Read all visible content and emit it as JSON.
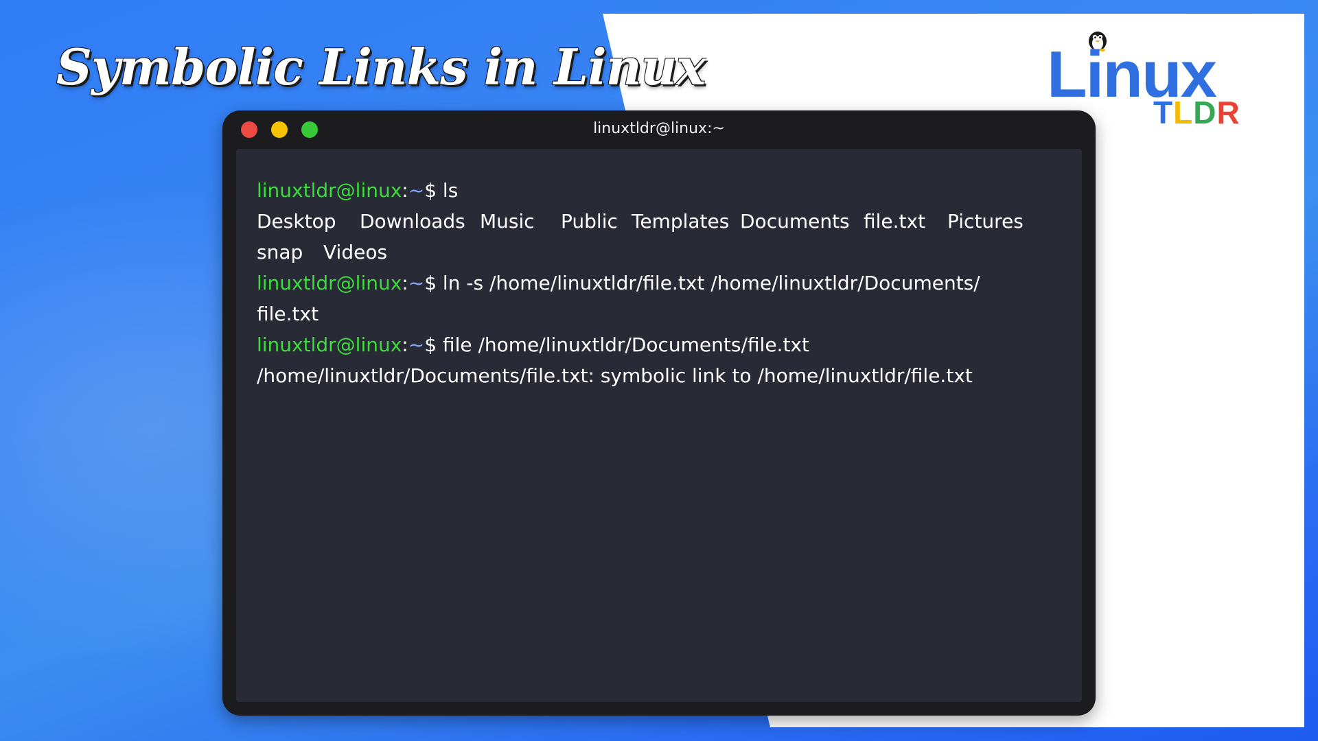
{
  "page": {
    "title": "Symbolic Links in Linux"
  },
  "logo": {
    "word": "Linux",
    "sub_letters": [
      {
        "char": "T",
        "color": "#2f6fe0"
      },
      {
        "char": "L",
        "color": "#f5b800"
      },
      {
        "char": "D",
        "color": "#34a853"
      },
      {
        "char": "R",
        "color": "#e84335"
      }
    ],
    "icon": "penguin-icon"
  },
  "colors": {
    "background_blue": "#2f7cf6",
    "terminal_frame": "#1c1c1e",
    "terminal_body": "#282a35",
    "prompt_user": "#3ddc3d",
    "prompt_tilde": "#8aa7ff",
    "close": "#ed4a44",
    "minimize": "#f5c300",
    "maximize": "#37c93a"
  },
  "terminal": {
    "title": "linuxtldr@linux:~",
    "prompt": {
      "user": "linuxtldr@linux",
      "colon": ":",
      "path": "~",
      "dollar": "$"
    },
    "commands": {
      "ls": " ls",
      "ln": " ln -s /home/linuxtldr/file.txt /home/linuxtldr/Documents/",
      "ln_wrap": "file.txt",
      "file": " file /home/linuxtldr/Documents/file.txt"
    },
    "ls_output_row1": [
      "Desktop",
      "Downloads",
      "Music",
      "Public",
      "Templates",
      "Documents",
      "file.txt",
      "Pictures"
    ],
    "ls_output_row2": [
      "snap",
      "Videos"
    ],
    "file_output": "/home/linuxtldr/Documents/file.txt: symbolic link to /home/linuxtldr/file.txt"
  }
}
